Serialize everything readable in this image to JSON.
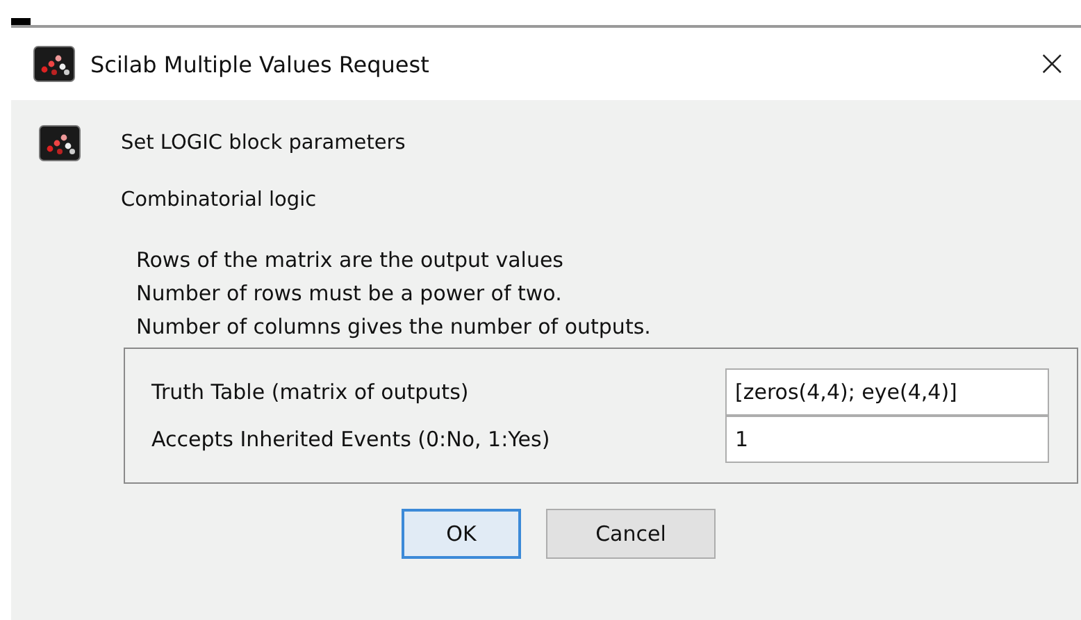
{
  "window": {
    "title": "Scilab Multiple Values Request",
    "close": "×"
  },
  "header": {
    "title": "Set LOGIC block parameters"
  },
  "subtitle": "Combinatorial logic",
  "description": [
    "Rows of the matrix are the output values",
    "Number of rows must be a power of two.",
    "Number of columns gives the number of outputs."
  ],
  "fields": [
    {
      "label": "Truth Table (matrix of outputs)",
      "value": "[zeros(4,4); eye(4,4)]"
    },
    {
      "label": "Accepts Inherited Events (0:No, 1:Yes)",
      "value": "1"
    }
  ],
  "buttons": [
    {
      "label": "OK",
      "focused": true
    },
    {
      "label": "Cancel",
      "focused": false
    }
  ]
}
